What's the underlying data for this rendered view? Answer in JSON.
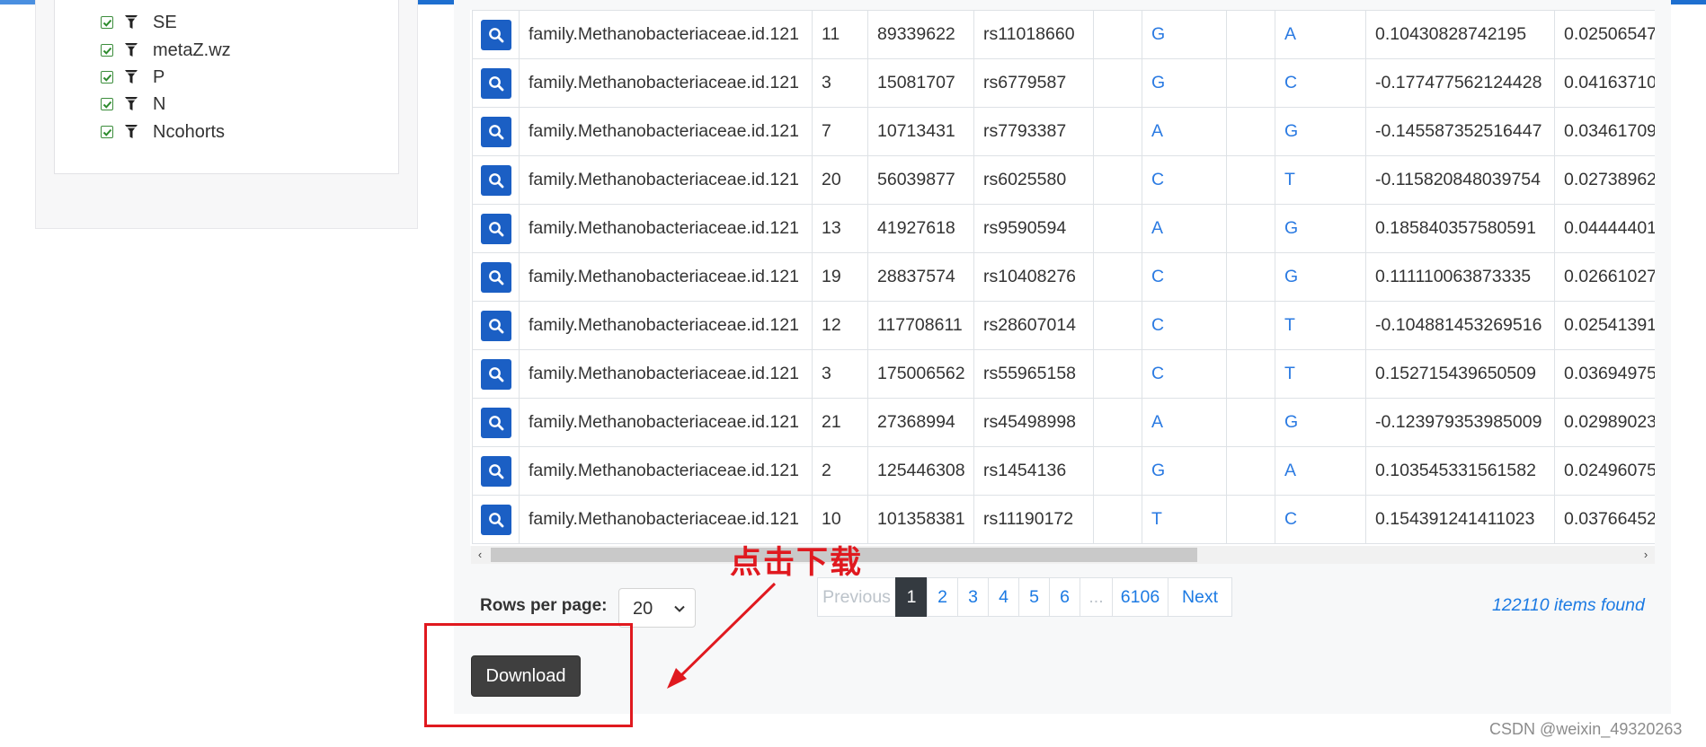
{
  "filters": [
    {
      "label": "SE"
    },
    {
      "label": "metaZ.wz"
    },
    {
      "label": "P"
    },
    {
      "label": "N"
    },
    {
      "label": "Ncohorts"
    }
  ],
  "table": {
    "rows": [
      [
        "family.Methanobacteriaceae.id.121",
        "11",
        "89339622",
        "rs11018660",
        "",
        "G",
        "",
        "A",
        "0.10430828742195",
        "0.02506547"
      ],
      [
        "family.Methanobacteriaceae.id.121",
        "3",
        "15081707",
        "rs6779587",
        "",
        "G",
        "",
        "C",
        "-0.177477562124428",
        "0.04163710"
      ],
      [
        "family.Methanobacteriaceae.id.121",
        "7",
        "10713431",
        "rs7793387",
        "",
        "A",
        "",
        "G",
        "-0.145587352516447",
        "0.03461709"
      ],
      [
        "family.Methanobacteriaceae.id.121",
        "20",
        "56039877",
        "rs6025580",
        "",
        "C",
        "",
        "T",
        "-0.115820848039754",
        "0.02738962"
      ],
      [
        "family.Methanobacteriaceae.id.121",
        "13",
        "41927618",
        "rs9590594",
        "",
        "A",
        "",
        "G",
        "0.185840357580591",
        "0.04444401"
      ],
      [
        "family.Methanobacteriaceae.id.121",
        "19",
        "28837574",
        "rs10408276",
        "",
        "C",
        "",
        "G",
        "0.111110063873335",
        "0.02661027"
      ],
      [
        "family.Methanobacteriaceae.id.121",
        "12",
        "117708611",
        "rs28607014",
        "",
        "C",
        "",
        "T",
        "-0.104881453269516",
        "0.02541391"
      ],
      [
        "family.Methanobacteriaceae.id.121",
        "3",
        "175006562",
        "rs55965158",
        "",
        "C",
        "",
        "T",
        "0.152715439650509",
        "0.03694975"
      ],
      [
        "family.Methanobacteriaceae.id.121",
        "21",
        "27368994",
        "rs45498998",
        "",
        "A",
        "",
        "G",
        "-0.123979353985009",
        "0.02989023"
      ],
      [
        "family.Methanobacteriaceae.id.121",
        "2",
        "125446308",
        "rs1454136",
        "",
        "G",
        "",
        "A",
        "0.103545331561582",
        "0.02496075"
      ],
      [
        "family.Methanobacteriaceae.id.121",
        "10",
        "101358381",
        "rs11190172",
        "",
        "T",
        "",
        "C",
        "0.154391241411023",
        "0.03766452"
      ]
    ]
  },
  "pagination": {
    "rows_per_page_label": "Rows per page:",
    "rows_per_page_value": "20",
    "previous": "Previous",
    "pages": [
      "1",
      "2",
      "3",
      "4",
      "5",
      "6",
      "...",
      "6106"
    ],
    "active_page": "1",
    "next": "Next",
    "items_found": "122110 items found"
  },
  "download_label": "Download",
  "annotation_text": "点击下载",
  "watermark": "CSDN @weixin_49320263",
  "colors": {
    "accent": "#1c7ae3",
    "search_button": "#1b5fc4",
    "annotation_red": "#e0191f",
    "download_button": "#3f3f3f",
    "active_page": "#343a40"
  },
  "icons": {
    "row_action": "search-icon",
    "filter": "filter-icon",
    "checkbox": "checkbox-checked-icon"
  }
}
